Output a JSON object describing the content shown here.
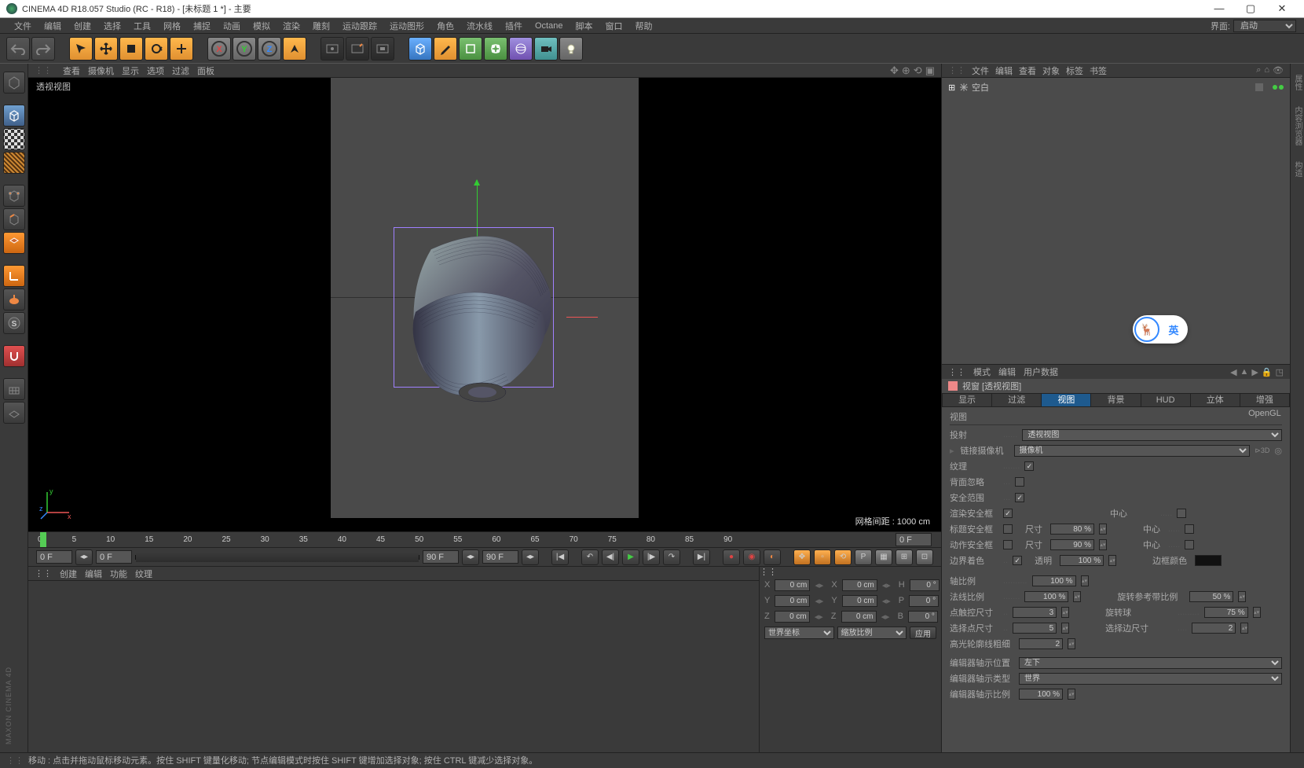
{
  "title": "CINEMA 4D R18.057 Studio (RC - R18) - [未标题 1 *] - 主要",
  "menu": [
    "文件",
    "编辑",
    "创建",
    "选择",
    "工具",
    "网格",
    "捕捉",
    "动画",
    "模拟",
    "渲染",
    "雕刻",
    "运动跟踪",
    "运动图形",
    "角色",
    "流水线",
    "插件",
    "Octane",
    "脚本",
    "窗口",
    "帮助"
  ],
  "menu_right": {
    "label": "界面:",
    "value": "启动"
  },
  "view_menu": [
    "查看",
    "摄像机",
    "显示",
    "选项",
    "过滤",
    "面板"
  ],
  "viewport": {
    "label": "透视视图",
    "grid_info": "网格间距 : 1000 cm"
  },
  "timeline": {
    "ticks": [
      "0",
      "5",
      "10",
      "15",
      "20",
      "25",
      "30",
      "35",
      "40",
      "45",
      "50",
      "55",
      "60",
      "65",
      "70",
      "75",
      "80",
      "85",
      "90"
    ],
    "end_input": "0 F",
    "start": "0 F",
    "current": "0 F",
    "end_a": "90 F",
    "end_b": "90 F"
  },
  "bottom_left_menu": [
    "创建",
    "编辑",
    "功能",
    "纹理"
  ],
  "coords": {
    "X": {
      "pos": "0 cm",
      "size": "0 cm",
      "h": "0 °"
    },
    "Y": {
      "pos": "0 cm",
      "size": "0 cm",
      "p": "0 °"
    },
    "Z": {
      "pos": "0 cm",
      "size": "0 cm",
      "b": "0 °"
    },
    "sel1": "世界坐标",
    "sel2": "缩放比例",
    "apply": "应用"
  },
  "obj_panel_menu": [
    "文件",
    "编辑",
    "查看",
    "对象",
    "标签",
    "书签"
  ],
  "obj_tree": {
    "root": "空白"
  },
  "attr_panel_menu": [
    "模式",
    "编辑",
    "用户数据"
  ],
  "attr_title": "视窗 [透视视图]",
  "tabs": [
    "显示",
    "过滤",
    "视图",
    "背景",
    "HUD",
    "立体",
    "增强OpenGL"
  ],
  "active_tab": 2,
  "view_section": "视图",
  "attrs": {
    "projection": {
      "label": "投射",
      "value": "透视视图"
    },
    "link_cam": {
      "label": "链接摄像机",
      "value": "摄像机"
    },
    "texture": {
      "label": "纹理",
      "checked": true
    },
    "ignore_bg": {
      "label": "背面忽略",
      "checked": false
    },
    "safe_zone": {
      "label": "安全范围",
      "checked": true
    },
    "render_safe": {
      "label": "渲染安全框",
      "checked": true
    },
    "title_safe": {
      "label": "标题安全框",
      "checked": false,
      "size_label": "尺寸",
      "size": "80 %",
      "center_label": "中心",
      "center": false
    },
    "action_safe": {
      "label": "动作安全框",
      "checked": false,
      "size_label": "尺寸",
      "size": "90 %",
      "center_label": "中心",
      "center": false
    },
    "border": {
      "label": "边界着色",
      "checked": true,
      "opacity_label": "透明",
      "opacity": "100 %",
      "frame_color_label": "边框颜色"
    },
    "axis_scale": {
      "label": "轴比例",
      "value": "100 %"
    },
    "normal_scale": {
      "label": "法线比例",
      "value": "100 %"
    },
    "rot_band": {
      "label": "旋转参考带比例",
      "value": "50 %"
    },
    "pt_touch": {
      "label": "点触控尺寸",
      "value": "3"
    },
    "rot_ball": {
      "label": "旋转球",
      "value": "75 %"
    },
    "sel_pt": {
      "label": "选择点尺寸",
      "value": "5"
    },
    "sel_edge": {
      "label": "选择边尺寸",
      "value": "2"
    },
    "hl_edge": {
      "label": "高光轮廓线粗细",
      "value": "2"
    },
    "editor_axis_pos": {
      "label": "编辑器轴示位置",
      "value": "左下"
    },
    "editor_axis_type": {
      "label": "编辑器轴示类型",
      "value": "世界"
    },
    "editor_axis_scale": {
      "label": "编辑器轴示比例",
      "value": "100 %"
    }
  },
  "floaty_text": "英",
  "status": "移动 : 点击并拖动鼠标移动元素。按住 SHIFT 键量化移动; 节点编辑模式时按住 SHIFT 键增加选择对象; 按住 CTRL 键减少选择对象。",
  "brand": "MAXON CINEMA 4D"
}
